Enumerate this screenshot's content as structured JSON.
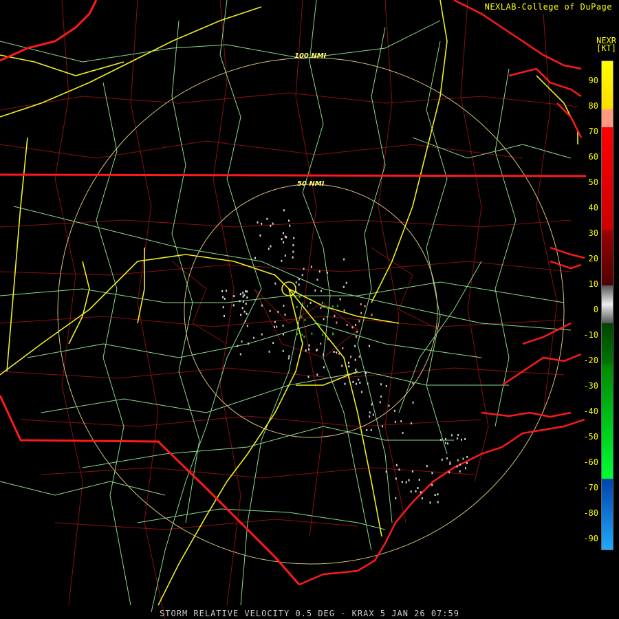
{
  "credit": "NEXLAB-College of DuPage",
  "product_code": "NEXR",
  "unit_label": "[KT]",
  "footer": "STORM RELATIVE VELOCITY 0.5 DEG - KRAX 5 JAN 26 07:59",
  "range_rings": [
    "100 NMI",
    "50 NMI"
  ],
  "scale": {
    "ticks": [
      "90",
      "80",
      "70",
      "60",
      "50",
      "40",
      "30",
      "20",
      "10",
      "0",
      "-10",
      "-20",
      "-30",
      "-40",
      "-50",
      "-60",
      "-70",
      "-80",
      "-90"
    ],
    "colors": {
      "top": "#ffff00",
      "upper": "#ff0000",
      "mid": "#800000",
      "zero": "#999999",
      "green": "#00dd22",
      "blue": "#0088ff"
    }
  },
  "colors": {
    "state_border": "#ff1a1a",
    "county": "#b01818",
    "interstate": "#f0f020",
    "highway": "#88dd88",
    "ring": "#d8c27a"
  }
}
